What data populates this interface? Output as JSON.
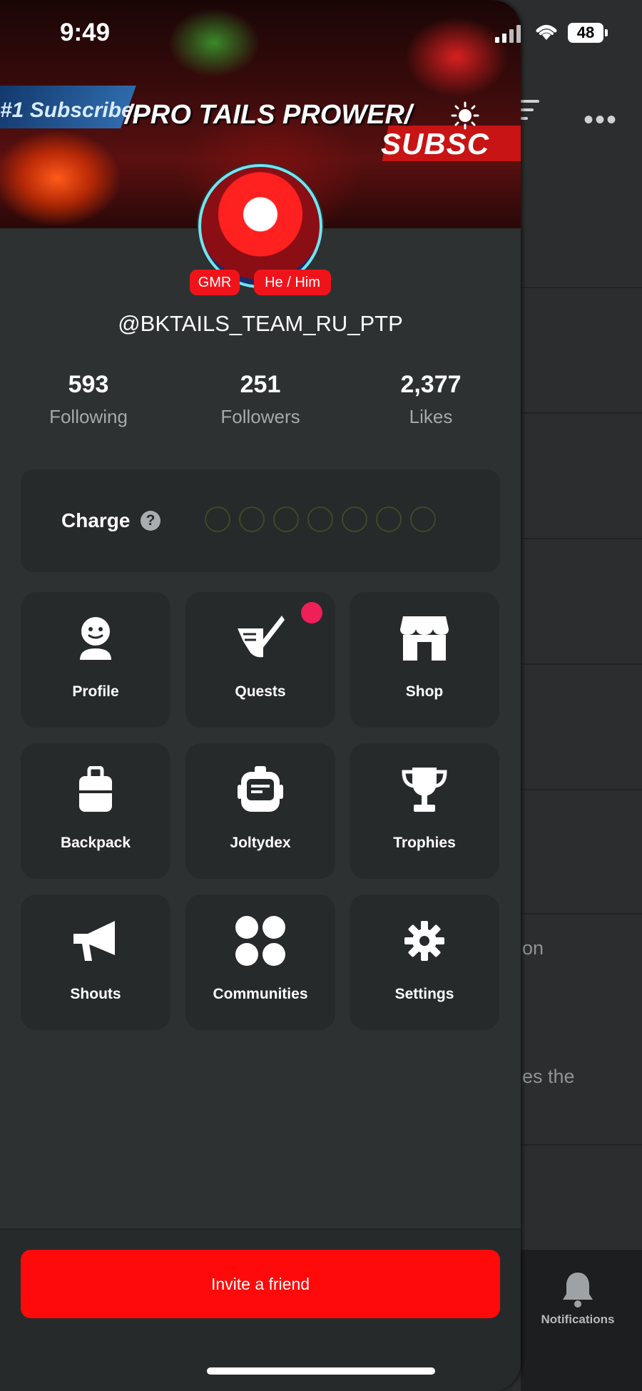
{
  "status_bar": {
    "time": "9:49",
    "battery": "48"
  },
  "banner": {
    "title": "/PRO TAILS PROWER/",
    "subscribe_text": "#1 Subscriber",
    "subsc_text": "SUBSC"
  },
  "profile": {
    "handle": "@BKTAILS_TEAM_RU_PTP",
    "badges": [
      "GMR",
      "He / Him"
    ]
  },
  "stats": [
    {
      "value": "593",
      "label": "Following"
    },
    {
      "value": "251",
      "label": "Followers"
    },
    {
      "value": "2,377",
      "label": "Likes"
    }
  ],
  "charge": {
    "label": "Charge",
    "help": "?",
    "filled": 0,
    "total": 7
  },
  "menu": [
    {
      "label": "Profile",
      "icon": "smiley-icon"
    },
    {
      "label": "Quests",
      "icon": "quest-icon",
      "has_notification": true
    },
    {
      "label": "Shop",
      "icon": "shop-icon"
    },
    {
      "label": "Backpack",
      "icon": "backpack-icon"
    },
    {
      "label": "Joltydex",
      "icon": "joltydex-icon"
    },
    {
      "label": "Trophies",
      "icon": "trophy-icon"
    },
    {
      "label": "Shouts",
      "icon": "megaphone-icon"
    },
    {
      "label": "Communities",
      "icon": "communities-icon"
    },
    {
      "label": "Settings",
      "icon": "gear-icon"
    }
  ],
  "invite_button": "Invite a friend",
  "background_app": {
    "partial_texts": [
      "on",
      "es the"
    ],
    "nav_label": "Notifications"
  },
  "colors": {
    "accent": "#ff0a0a",
    "notification_dot": "#ef1f57",
    "drawer_bg": "#2e3132",
    "tile_bg": "#262a2b"
  }
}
